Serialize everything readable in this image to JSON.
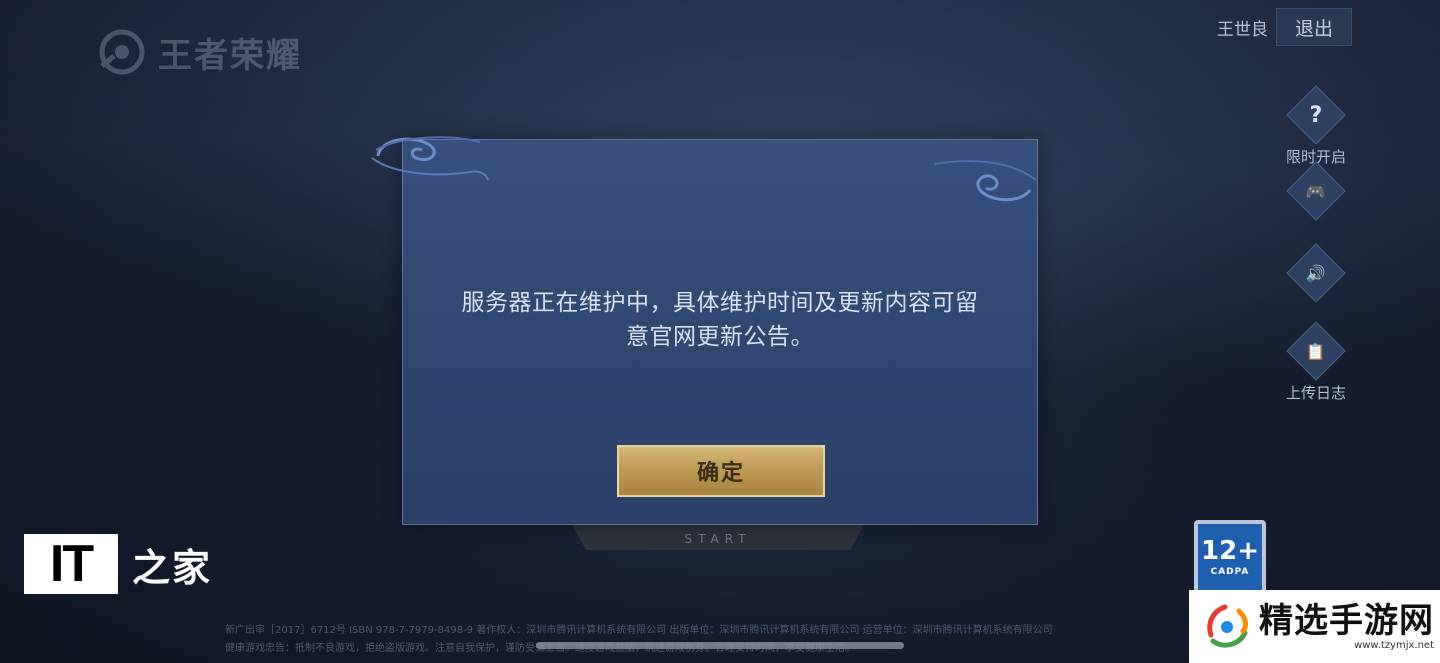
{
  "app": {
    "logo_text": "王者荣耀"
  },
  "header": {
    "user_name": "王世良",
    "logout_label": "退出"
  },
  "side_buttons": [
    {
      "icon": "question-icon",
      "glyph": "?",
      "label": "限时开启"
    },
    {
      "icon": "gamepad-icon",
      "glyph": "🎮",
      "label": ""
    },
    {
      "icon": "speaker-icon",
      "glyph": "🔊",
      "label": ""
    },
    {
      "icon": "clipboard-icon",
      "glyph": "📋",
      "label": "上传日志"
    }
  ],
  "start_button": {
    "label": "START"
  },
  "age_rating": {
    "value": "12+",
    "sub": "CADPA"
  },
  "footer": {
    "line1": "新广出审［2017］6712号  ISBN 978-7-7979-8498-9  著作权人：深圳市腾讯计算机系统有限公司  出版单位：深圳市腾讯计算机系统有限公司  运营单位：深圳市腾讯计算机系统有限公司",
    "line2": "健康游戏忠告：抵制不良游戏，拒绝盗版游戏。注意自我保护，谨防受骗上当。适度游戏益脑，沉迷游戏伤身。合理安排时间，享受健康生活。"
  },
  "dialog": {
    "message_line1": "服务器正在维护中，具体维护时间及更新内容可留",
    "message_line2": "意官网更新公告。",
    "confirm_label": "确定"
  },
  "watermarks": {
    "it_box": "IT",
    "it_chars": "之家",
    "site_name": "精选手游网",
    "site_url": "www.tzymjx.net"
  },
  "colors": {
    "dialog_bg": "#2d4770",
    "confirm_gold": "#c9a862",
    "age_blue": "#1f5fb0"
  }
}
